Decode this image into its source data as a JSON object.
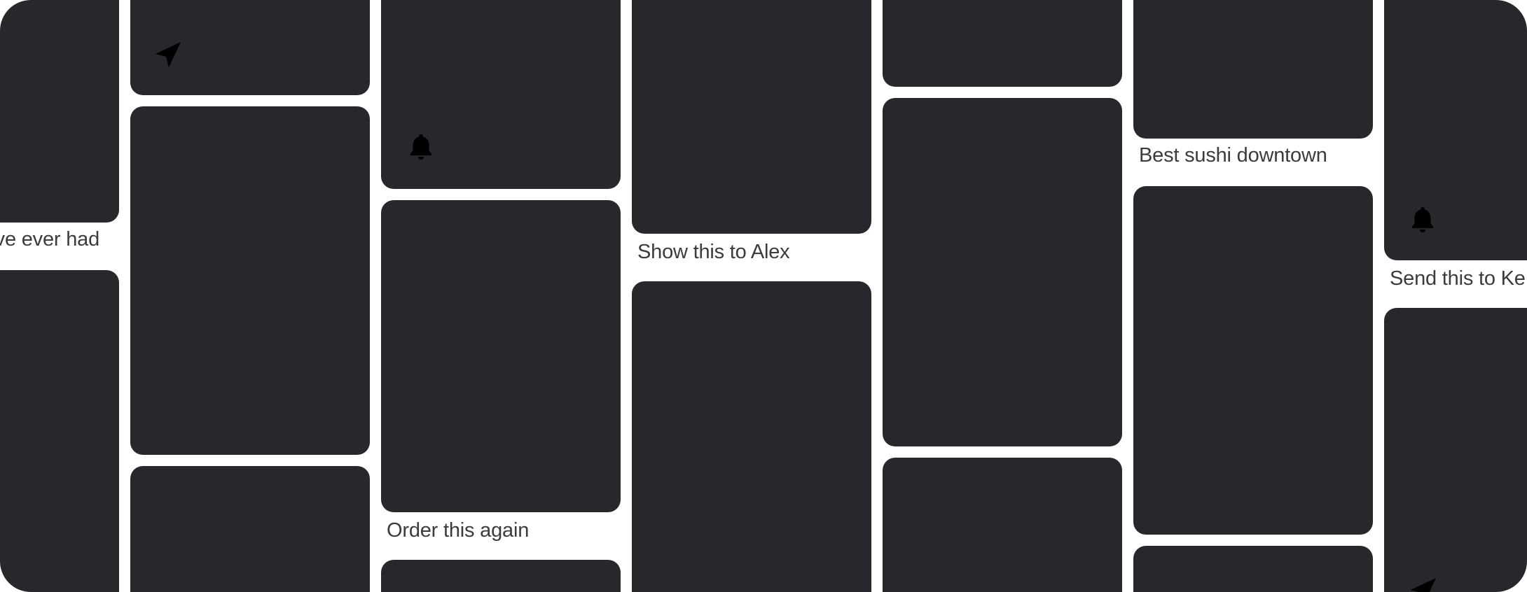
{
  "colors": {
    "page_bg": "#ffffff",
    "card": "#27282c",
    "caption_text": "#3b3c40",
    "icon": "#000000"
  },
  "captions": {
    "col1": "ve ever had",
    "col3": "Order this again",
    "col4": "Show this to Alex",
    "col6": "Best sushi downtown",
    "col7": "Send this to Ke"
  },
  "icons": {
    "col2_top": "send-arrow-icon",
    "col3_top": "bell-icon",
    "col7_top": "bell-icon",
    "col7_bottom": "send-arrow-icon"
  }
}
